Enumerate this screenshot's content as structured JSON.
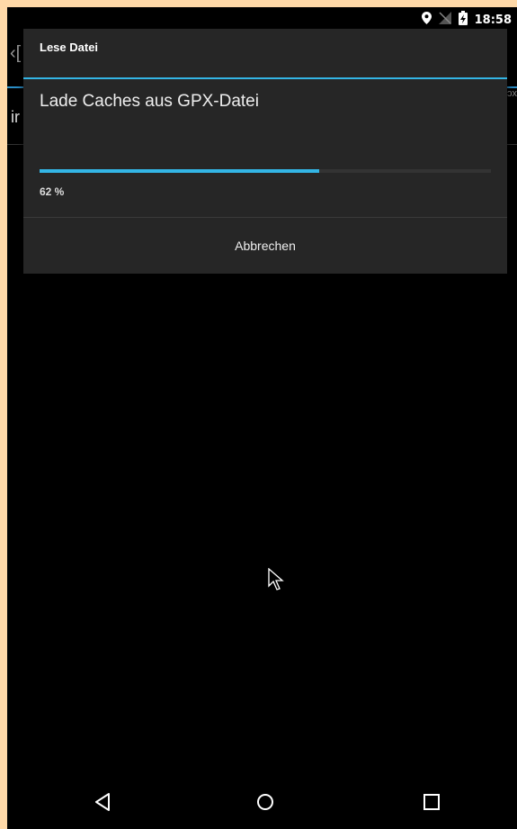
{
  "status_bar": {
    "time": "18:58",
    "icons": [
      "location-icon",
      "no-signal-icon",
      "battery-charging-icon"
    ]
  },
  "background": {
    "back_glyph": "‹[",
    "row_text": "ir",
    "right_text": "ɔx"
  },
  "dialog": {
    "title": "Lese Datei",
    "message": "Lade Caches aus GPX-Datei",
    "progress": 0.62,
    "progress_text": "62 %",
    "cancel_label": "Abbrechen"
  },
  "colors": {
    "accent": "#33b5e5",
    "dialog_bg": "#262626",
    "screen_bg": "#000000",
    "frame_bg": "#ffd9a8"
  },
  "nav_bar": {
    "icons": [
      "back-icon",
      "home-icon",
      "recents-icon"
    ]
  }
}
